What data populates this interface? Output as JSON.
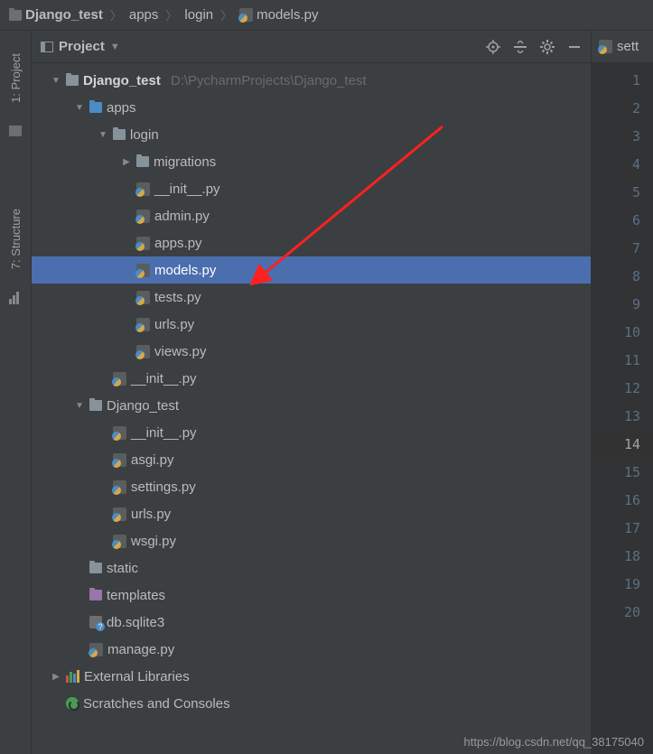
{
  "breadcrumb": [
    {
      "label": "Django_test",
      "icon": "folder",
      "bold": true
    },
    {
      "label": "apps",
      "icon": "folder"
    },
    {
      "label": "login",
      "icon": "folder"
    },
    {
      "label": "models.py",
      "icon": "python"
    }
  ],
  "sidebar_tabs": {
    "project": "1: Project",
    "structure": "7: Structure"
  },
  "panel": {
    "title": "Project"
  },
  "tree": [
    {
      "indent": 0,
      "toggle": "down",
      "icon": "folder-gray",
      "label": "Django_test",
      "bold": true,
      "path": "D:\\PycharmProjects\\Django_test"
    },
    {
      "indent": 1,
      "toggle": "down",
      "icon": "folder-blue",
      "label": "apps"
    },
    {
      "indent": 2,
      "toggle": "down",
      "icon": "folder-gray",
      "label": "login"
    },
    {
      "indent": 3,
      "toggle": "right",
      "icon": "folder-gray",
      "label": "migrations"
    },
    {
      "indent": 3,
      "toggle": "",
      "icon": "python",
      "label": "__init__.py"
    },
    {
      "indent": 3,
      "toggle": "",
      "icon": "python",
      "label": "admin.py"
    },
    {
      "indent": 3,
      "toggle": "",
      "icon": "python",
      "label": "apps.py"
    },
    {
      "indent": 3,
      "toggle": "",
      "icon": "python",
      "label": "models.py",
      "selected": true
    },
    {
      "indent": 3,
      "toggle": "",
      "icon": "python",
      "label": "tests.py"
    },
    {
      "indent": 3,
      "toggle": "",
      "icon": "python",
      "label": "urls.py"
    },
    {
      "indent": 3,
      "toggle": "",
      "icon": "python",
      "label": "views.py"
    },
    {
      "indent": 2,
      "toggle": "",
      "icon": "python",
      "label": "__init__.py"
    },
    {
      "indent": 1,
      "toggle": "down",
      "icon": "folder-gray",
      "label": "Django_test"
    },
    {
      "indent": 2,
      "toggle": "",
      "icon": "python",
      "label": "__init__.py"
    },
    {
      "indent": 2,
      "toggle": "",
      "icon": "python",
      "label": "asgi.py"
    },
    {
      "indent": 2,
      "toggle": "",
      "icon": "python",
      "label": "settings.py"
    },
    {
      "indent": 2,
      "toggle": "",
      "icon": "python",
      "label": "urls.py"
    },
    {
      "indent": 2,
      "toggle": "",
      "icon": "python",
      "label": "wsgi.py"
    },
    {
      "indent": 1,
      "toggle": "",
      "icon": "folder-gray",
      "label": "static"
    },
    {
      "indent": 1,
      "toggle": "",
      "icon": "folder-purple",
      "label": "templates"
    },
    {
      "indent": 1,
      "toggle": "",
      "icon": "db",
      "label": "db.sqlite3"
    },
    {
      "indent": 1,
      "toggle": "",
      "icon": "python",
      "label": "manage.py"
    },
    {
      "indent": 0,
      "toggle": "right",
      "icon": "lib",
      "label": "External Libraries"
    },
    {
      "indent": 0,
      "toggle": "",
      "icon": "scratch",
      "label": "Scratches and Consoles"
    }
  ],
  "editor": {
    "tab_label": "sett",
    "lines": [
      1,
      2,
      3,
      4,
      5,
      6,
      7,
      8,
      9,
      10,
      11,
      12,
      13,
      14,
      15,
      16,
      17,
      18,
      19,
      20
    ],
    "active_line": 14
  },
  "watermark": "https://blog.csdn.net/qq_38175040"
}
